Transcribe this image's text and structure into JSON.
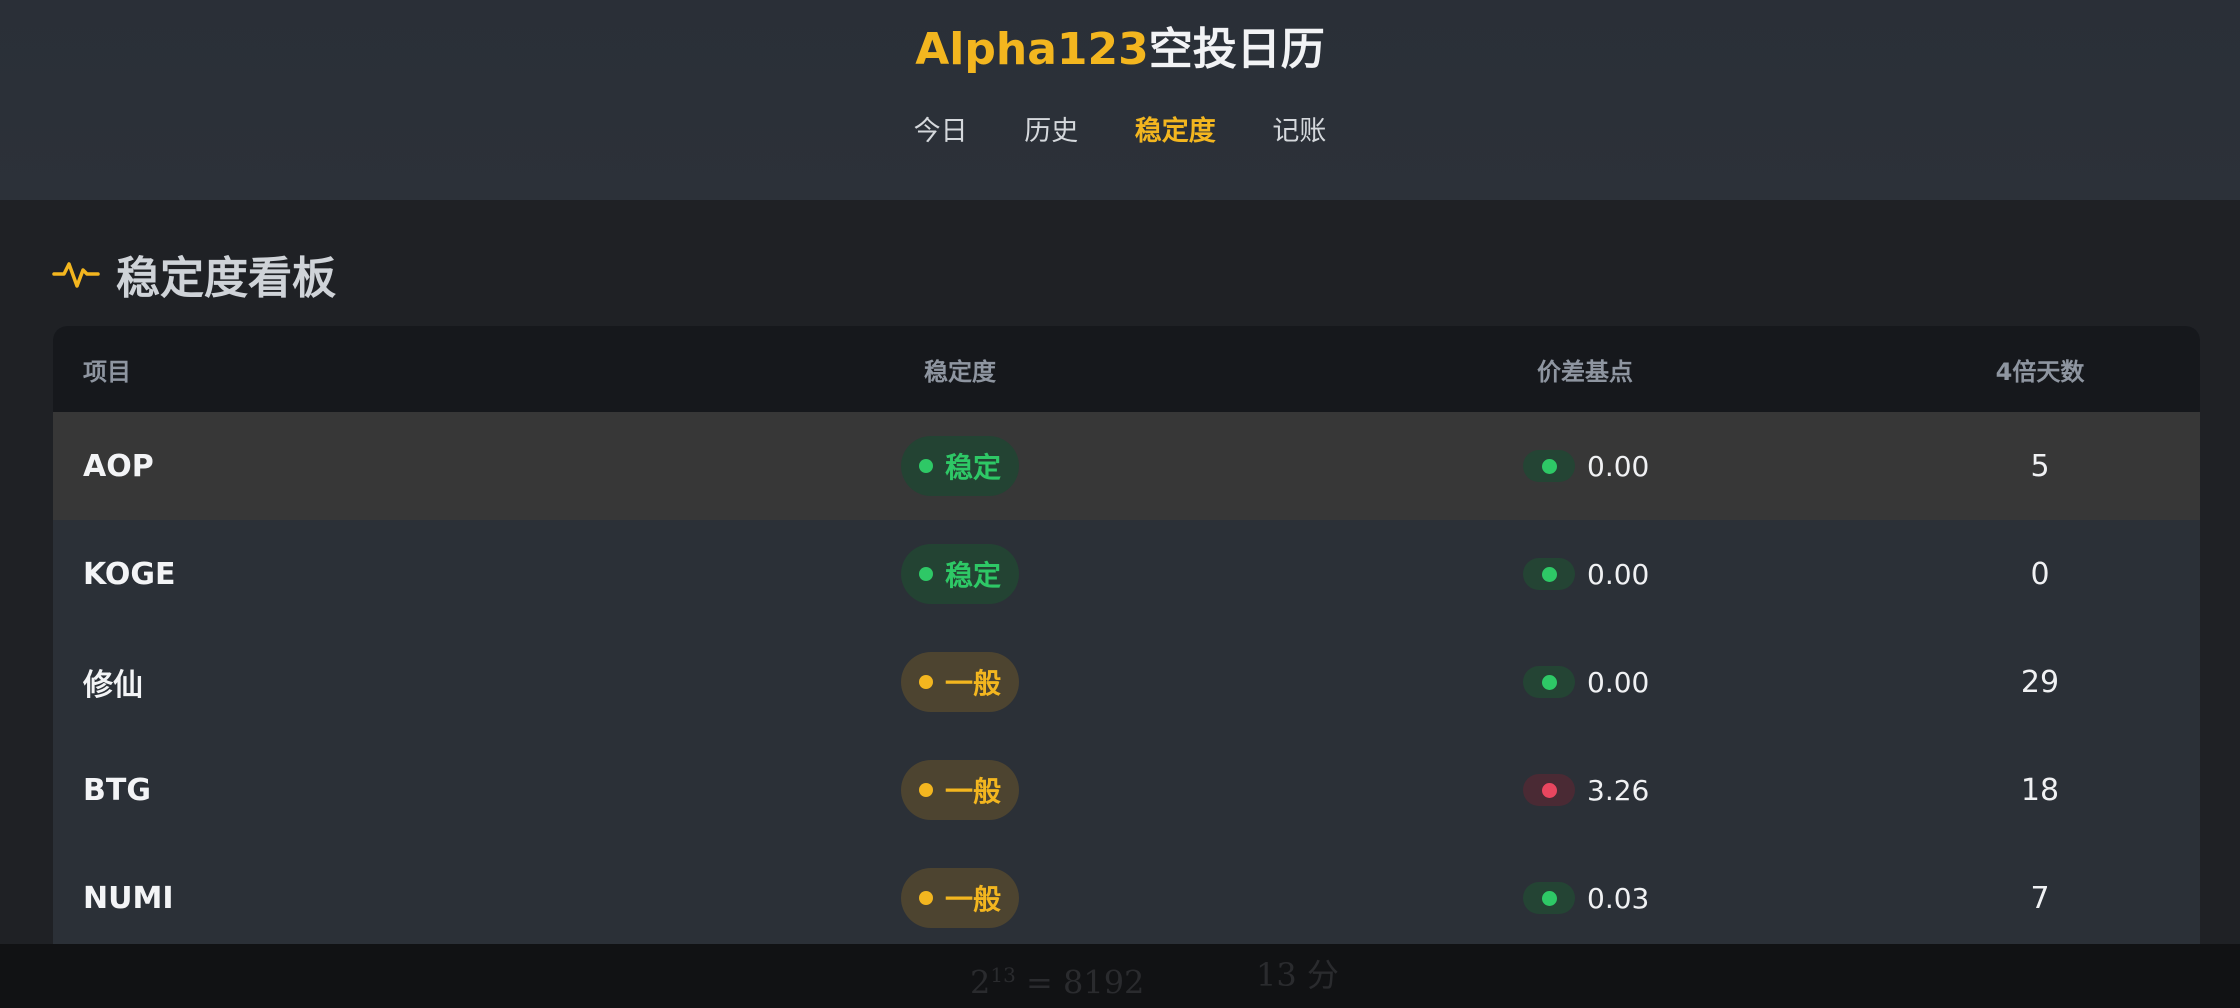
{
  "header": {
    "brand_accent": "Alpha123",
    "brand_rest": "空投日历",
    "nav": [
      "今日",
      "历史",
      "稳定度",
      "记账"
    ],
    "active_index": 2
  },
  "section": {
    "title": "稳定度看板",
    "icon": "activity-icon"
  },
  "table": {
    "columns": [
      "项目",
      "稳定度",
      "价差基点",
      "4倍天数"
    ],
    "rows": [
      {
        "project": "AOP",
        "stability": "稳定",
        "stability_level": "green",
        "spread_status": "green",
        "spread": "0.00",
        "days": "5"
      },
      {
        "project": "KOGE",
        "stability": "稳定",
        "stability_level": "green",
        "spread_status": "green",
        "spread": "0.00",
        "days": "0"
      },
      {
        "project": "修仙",
        "stability": "一般",
        "stability_level": "yellow",
        "spread_status": "green",
        "spread": "0.00",
        "days": "29"
      },
      {
        "project": "BTG",
        "stability": "一般",
        "stability_level": "yellow",
        "spread_status": "red",
        "spread": "3.26",
        "days": "18"
      },
      {
        "project": "NUMI",
        "stability": "一般",
        "stability_level": "yellow",
        "spread_status": "green",
        "spread": "0.03",
        "days": "7"
      }
    ]
  },
  "overlay": {
    "formula_base": "2",
    "formula_exp": "13",
    "formula_rest": " = 8192",
    "time": "13 分"
  },
  "colors": {
    "accent": "#f3b61f",
    "green": "#2ec866",
    "red": "#e8465f"
  }
}
